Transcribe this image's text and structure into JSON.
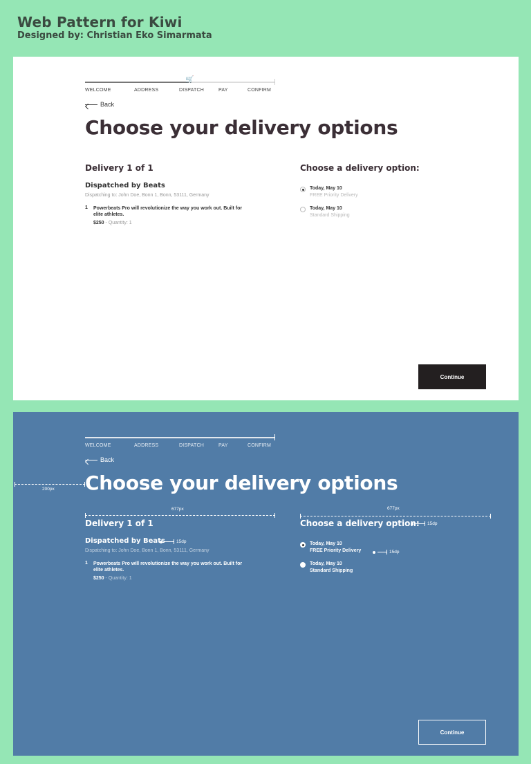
{
  "header": {
    "title": "Web Pattern for Kiwi",
    "subtitle": "Designed by: Christian Eko Simarmata"
  },
  "checkout": {
    "steps": [
      "WELCOME",
      "ADDRESS",
      "DISPATCH",
      "PAY",
      "CONFIRM"
    ],
    "cart_icon": "shopping-cart-icon",
    "back_label": "Back",
    "title": "Choose your delivery options",
    "delivery_heading": "Delivery 1 of 1",
    "options_heading": "Choose a delivery option:",
    "dispatched_by": "Dispatched by Beats",
    "dispatching_to": "Dispatching to: John Doe, Bonn 1, Bonn, 53111, Germany",
    "item": {
      "number": "1",
      "description": "Powerbeats Pro will revolutionize the way you work out. Built for elite athletes.",
      "price": "$250",
      "separator": " - ",
      "quantity": "Quantity: 1"
    },
    "options": [
      {
        "date": "Today, May 10",
        "label": "FREE Priority Delivery",
        "selected": true
      },
      {
        "date": "Today, May 10",
        "label": "Standard Shipping",
        "selected": false
      }
    ],
    "continue_label": "Continue"
  },
  "annotations": {
    "margin_label": "200px",
    "column_left_label": "677px",
    "column_right_label": "677px",
    "spacing_label": "15dp"
  },
  "colors": {
    "background": "#95e6b5",
    "blue_panel": "#517ca7",
    "title_dark": "#3b2f36",
    "button_dark": "#231f20"
  }
}
